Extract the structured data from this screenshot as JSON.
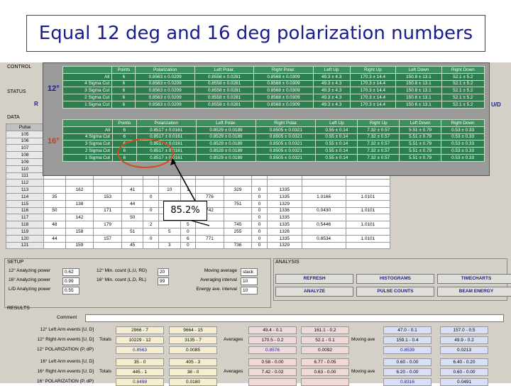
{
  "slide_title": "Equal 12 deg and 16 deg polarization numbers",
  "callout_text": "85.2%",
  "labels": {
    "control": "CONTROL",
    "status": "STATUS",
    "data": "DATA",
    "setup": "SETUP",
    "analysis": "ANALYSIS",
    "results": "RESULTS",
    "comment": "Comment",
    "side_r": "R",
    "side_ud": "U/D"
  },
  "popup": {
    "headers": [
      "Points",
      "Polarization",
      "Left Polar.",
      "Right Polar.",
      "Left Up",
      "Right Up",
      "Left Down",
      "Right Down"
    ],
    "deg12": {
      "angle": "12°",
      "rows": [
        {
          "label": "All",
          "cells": [
            "6",
            "0.8563 ± 0.0209",
            "0.8558 ± 0.0281",
            "0.8568 ± 0.0309",
            "49.3 ± 4.3",
            "170.3 ± 14.4",
            "150.8 ± 13.1",
            "52.1 ± 5.2"
          ]
        },
        {
          "label": "4 Sigma Cut",
          "cells": [
            "6",
            "0.8563 ± 0.0209",
            "0.8558 ± 0.0281",
            "0.8568 ± 0.0309",
            "49.3 ± 4.3",
            "170.3 ± 14.4",
            "150.8 ± 13.1",
            "52.1 ± 5.2"
          ]
        },
        {
          "label": "3 Sigma Cut",
          "cells": [
            "6",
            "0.8563 ± 0.0209",
            "0.8558 ± 0.0281",
            "0.8568 ± 0.0309",
            "49.3 ± 4.3",
            "170.3 ± 14.4",
            "150.8 ± 13.1",
            "52.1 ± 5.2"
          ]
        },
        {
          "label": "2 Sigma Cut",
          "cells": [
            "6",
            "0.8563 ± 0.0209",
            "0.8558 ± 0.0281",
            "0.8568 ± 0.0309",
            "49.3 ± 4.3",
            "170.3 ± 14.4",
            "150.6 ± 13.1",
            "52.1 ± 5.2"
          ]
        },
        {
          "label": "1 Sigma Cut",
          "cells": [
            "6",
            "0.8563 ± 0.0209",
            "0.8558 ± 0.0281",
            "0.8568 ± 0.0309",
            "49.3 ± 4.3",
            "170.3 ± 14.4",
            "150.6 ± 13.1",
            "52.1 ± 5.2"
          ]
        }
      ]
    },
    "deg16": {
      "angle": "16°",
      "rows": [
        {
          "label": "All",
          "cells": [
            "6",
            "0.8517 ± 0.0161",
            "0.8529 ± 0.0189",
            "0.8505 ± 0.0321",
            "0.55 ± 0.14",
            "7.32 ± 0.57",
            "5.51 ± 0.79",
            "0.53 ± 0.33"
          ]
        },
        {
          "label": "4 Sigma Cut",
          "cells": [
            "6",
            "0.8517 ± 0.0161",
            "0.8529 ± 0.0189",
            "0.8505 ± 0.0321",
            "0.55 ± 0.14",
            "7.32 ± 0.57",
            "5.51 ± 0.79",
            "0.53 ± 0.33"
          ]
        },
        {
          "label": "3 Sigma Cut",
          "cells": [
            "6",
            "0.8517 ± 0.0161",
            "0.8529 ± 0.0189",
            "0.8505 ± 0.0321",
            "0.55 ± 0.14",
            "7.32 ± 0.57",
            "5.51 ± 0.79",
            "0.53 ± 0.33"
          ]
        },
        {
          "label": "2 Sigma Cut",
          "cells": [
            "6",
            "0.8517 ± 0.0161",
            "0.8529 ± 0.0189",
            "0.8505 ± 0.0321",
            "0.55 ± 0.14",
            "7.32 ± 0.57",
            "5.51 ± 0.79",
            "0.53 ± 0.33"
          ]
        },
        {
          "label": "1 Sigma Cut",
          "cells": [
            "6",
            "0.8517 ± 0.0161",
            "0.8529 ± 0.0189",
            "0.8505 ± 0.0321",
            "0.55 ± 0.14",
            "7.32 ± 0.57",
            "5.51 ± 0.79",
            "0.53 ± 0.33"
          ]
        }
      ]
    }
  },
  "data_table": {
    "header": "Pulse",
    "rows": [
      [
        "105",
        "",
        "",
        "",
        "",
        "",
        "",
        "",
        "",
        "",
        "",
        "",
        "",
        ""
      ],
      [
        "106",
        "",
        "",
        "",
        "",
        "",
        "",
        "",
        "",
        "",
        "",
        "",
        "",
        ""
      ],
      [
        "107",
        "",
        "",
        "",
        "",
        "",
        "",
        "",
        "",
        "",
        "",
        "",
        "",
        ""
      ],
      [
        "108",
        "",
        "",
        "",
        "",
        "",
        "",
        "",
        "",
        "",
        "",
        "",
        "",
        ""
      ],
      [
        "109",
        "",
        "",
        "",
        "",
        "",
        "",
        "",
        "",
        "",
        "",
        "",
        "",
        ""
      ],
      [
        "110",
        "",
        "",
        "",
        "",
        "",
        "",
        "",
        "",
        "",
        "",
        "",
        "",
        ""
      ],
      [
        "111",
        "",
        "",
        "",
        "",
        "",
        "",
        "",
        "",
        "",
        "",
        "",
        "",
        ""
      ],
      [
        "112",
        "",
        "",
        "",
        "",
        "",
        "",
        "",
        "",
        "",
        "",
        "",
        "",
        ""
      ],
      [
        "113",
        "",
        "162",
        "",
        "41",
        "",
        "10",
        "1",
        "",
        "329",
        "0",
        "1335",
        "",
        ""
      ],
      [
        "114",
        "35",
        "",
        "153",
        "",
        "0",
        "",
        "",
        "776",
        "",
        "0",
        "1335",
        "1.0166",
        "1.0101"
      ],
      [
        "115",
        "",
        "138",
        "",
        "44",
        "",
        "",
        "",
        "",
        "751",
        "0",
        "1329",
        "",
        ""
      ],
      [
        "116",
        "50",
        "",
        "171",
        "",
        "0",
        "",
        "",
        "742",
        "",
        "0",
        "1336",
        "0.0430",
        "1.0101"
      ],
      [
        "117",
        "",
        "142",
        "",
        "50",
        "",
        "",
        "",
        "",
        "",
        "0",
        "1335",
        "",
        ""
      ],
      [
        "118",
        "48",
        "",
        "179",
        "",
        "2",
        "",
        "5",
        "",
        "745",
        "0",
        "1335",
        "0.5446",
        "1.0101"
      ],
      [
        "119",
        "",
        "158",
        "",
        "51",
        "",
        "5",
        "0",
        "",
        "255",
        "0",
        "1326",
        "",
        ""
      ],
      [
        "120",
        "44",
        "",
        "157",
        "",
        "0",
        "",
        "6",
        "771",
        "",
        "0",
        "1335",
        "0.8534",
        "1.0101"
      ],
      [
        "121",
        "",
        "159",
        "",
        "45",
        "",
        "3",
        "0",
        "",
        "736",
        "0",
        "1329",
        "",
        ""
      ]
    ]
  },
  "setup": {
    "rows": [
      {
        "label": "12° Analyzing power",
        "value": "0.62",
        "label2": "12° Min. count (L,U, RD)",
        "value2": "20",
        "label3": "Moving average",
        "value3": "stack"
      },
      {
        "label": "16° Analyzing power",
        "value": "0.99",
        "label2": "16° Min. count (L,D, RL)",
        "value2": "99",
        "label3": "Averaging interval",
        "value3": "10"
      },
      {
        "label": "L/D Analyzing power",
        "value": "0.55",
        "label2": "",
        "value2": "",
        "label3": "Energy ave. interval",
        "value3": "10"
      }
    ]
  },
  "analysis_buttons": [
    "REFRESH",
    "HISTOGRAMS",
    "TIMECHARTS",
    "ANALYZE",
    "PULSE COUNTS",
    "BEAM ENERGY"
  ],
  "results": {
    "rows": [
      {
        "label": "12° Left Arm events [U, D]",
        "v1": "2966 - 7",
        "v2": "9664 - 15",
        "mid": "",
        "v3": "49.4 - 0.1",
        "v4": "161.1 - 0.2",
        "mv": "",
        "v5": "47.0 - 0.1",
        "v6": "157.0 - 0.5"
      },
      {
        "label": "12° Right Arm events [U, D]",
        "v1": "10229 - 12",
        "v2": "3135 - 7",
        "mid": "Averages",
        "v3": "170.5 - 0.2",
        "v4": "52.1 - 0.1",
        "mv": "Moving ave",
        "v5": "159.1 - 0.4",
        "v6": "49.9 - 0.2"
      },
      {
        "label": "12° POLARIZATION (P, dP)",
        "v1": "0.8563",
        "v2": "0.0085",
        "mid": "",
        "v3": "0.8576",
        "v4": "0.0092",
        "mv": "",
        "v5": "0.8539",
        "v6": "0.0213"
      },
      {
        "label": "16° Left Arm events [U, D]",
        "v1": "35 - 0",
        "v2": "405 - 3",
        "mid": "",
        "v3": "0.58 - 0.00",
        "v4": "6.77 - 0.05",
        "mv": "",
        "v5": "0.60 - 0.00",
        "v6": "6.40 - 0.20"
      },
      {
        "label": "16° Right Arm events [U, D]",
        "v1": "445 - 1",
        "v2": "38 - 0",
        "mid": "Averages",
        "v3": "7.42 - 0.02",
        "v4": "0.63 - 0.00",
        "mv": "Moving ave",
        "v5": "6.20 - 0.00",
        "v6": "0.60 - 0.00"
      },
      {
        "label": "16° POLARIZATION (P, dP)",
        "v1": "0.8498",
        "v2": "0.0180",
        "mid": "",
        "v3": "",
        "v4": "",
        "mv": "",
        "v5": "0.8316",
        "v6": "0.0491"
      }
    ],
    "totals_label": "Totals"
  },
  "colors": {
    "accent": "#1a1a8c",
    "table_green": "#2e7d4f",
    "highlight": "#d44b20"
  }
}
